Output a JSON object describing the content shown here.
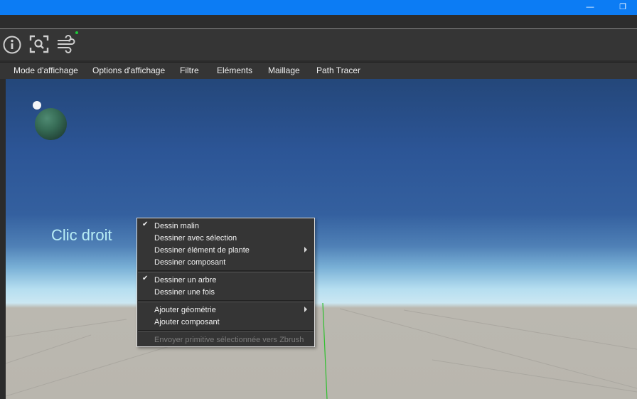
{
  "window": {
    "minimize_glyph": "—",
    "restore_glyph": "❐"
  },
  "toolbar": {
    "icons": [
      "info-icon",
      "zoom-to-selection-icon",
      "wind-icon"
    ]
  },
  "menubar": {
    "items": [
      "Mode d'affichage",
      "Options d'affichage",
      "Filtre",
      "Eléments",
      "Maillage",
      "Path Tracer"
    ]
  },
  "viewport": {
    "annotation": "Clic droit"
  },
  "context_menu": {
    "groups": [
      {
        "items": [
          {
            "label": "Dessin malin",
            "checked": true,
            "submenu": false
          },
          {
            "label": "Dessiner avec sélection",
            "checked": false,
            "submenu": false
          },
          {
            "label": "Dessiner élément de plante",
            "checked": false,
            "submenu": true
          },
          {
            "label": "Dessiner composant",
            "checked": false,
            "submenu": false
          }
        ]
      },
      {
        "items": [
          {
            "label": "Dessiner un arbre",
            "checked": true,
            "submenu": false
          },
          {
            "label": "Dessiner une fois",
            "checked": false,
            "submenu": false
          }
        ]
      },
      {
        "items": [
          {
            "label": "Ajouter géométrie",
            "checked": false,
            "submenu": true
          },
          {
            "label": "Ajouter composant",
            "checked": false,
            "submenu": false
          }
        ]
      },
      {
        "items": [
          {
            "label": "Envoyer primitive sélectionnée vers Zbrush",
            "checked": false,
            "submenu": false,
            "disabled": true
          }
        ]
      }
    ],
    "check_glyph": "✔"
  },
  "colors": {
    "titlebar": "#0c7cf4",
    "panel": "#353535",
    "sky_top": "#24477a",
    "horizon": "#cbe7f2",
    "ground": "#b9b6ae",
    "axis_green": "#2ec02e"
  }
}
